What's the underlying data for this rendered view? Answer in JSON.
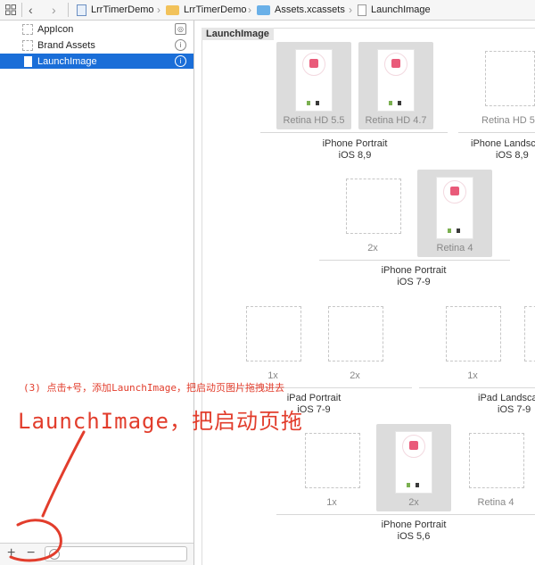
{
  "breadcrumb": {
    "project": "LrrTimerDemo",
    "group": "LrrTimerDemo",
    "catalog": "Assets.xcassets",
    "asset": "LaunchImage"
  },
  "sidebar": {
    "items": [
      {
        "label": "AppIcon",
        "badge": "icon-badge",
        "selected": false
      },
      {
        "label": "Brand Assets",
        "badge": "info-badge",
        "selected": false
      },
      {
        "label": "LaunchImage",
        "badge": "info-badge",
        "selected": true
      }
    ],
    "bottom": {
      "add": "+",
      "remove": "−",
      "filter_placeholder": ""
    }
  },
  "main": {
    "set_title": "LaunchImage",
    "groups": [
      {
        "line1": "iPhone Portrait",
        "line2": "iOS 8,9"
      },
      {
        "line1": "iPhone Landsc",
        "line2": "iOS 8,9"
      },
      {
        "line1": "iPhone Portrait",
        "line2": "iOS 7-9"
      },
      {
        "line1": "iPad Portrait",
        "line2": "iOS 7-9"
      },
      {
        "line1": "iPad Landsca",
        "line2": "iOS 7-9"
      },
      {
        "line1": "iPhone Portrait",
        "line2": "iOS 5,6"
      }
    ],
    "slots": [
      {
        "label": "Retina HD 5.5",
        "filled": true
      },
      {
        "label": "Retina HD 4.7",
        "filled": true
      },
      {
        "label": "Retina HD 5",
        "filled": false
      },
      {
        "label": "2x",
        "filled": false
      },
      {
        "label": "Retina 4",
        "filled": true
      },
      {
        "label": "1x",
        "filled": false
      },
      {
        "label": "2x",
        "filled": false
      },
      {
        "label": "1x",
        "filled": false
      },
      {
        "label": "1x",
        "filled": false
      },
      {
        "label": "2x",
        "filled": true
      },
      {
        "label": "Retina 4",
        "filled": false
      }
    ]
  },
  "annotation": {
    "line1": "(3) 点击+号，添加LaunchImage，把启动页图片拖拽进去",
    "line2": "LaunchImage，把启动页拖"
  },
  "colors": {
    "selection": "#1a6ed8",
    "annotation": "#e23d2c"
  }
}
